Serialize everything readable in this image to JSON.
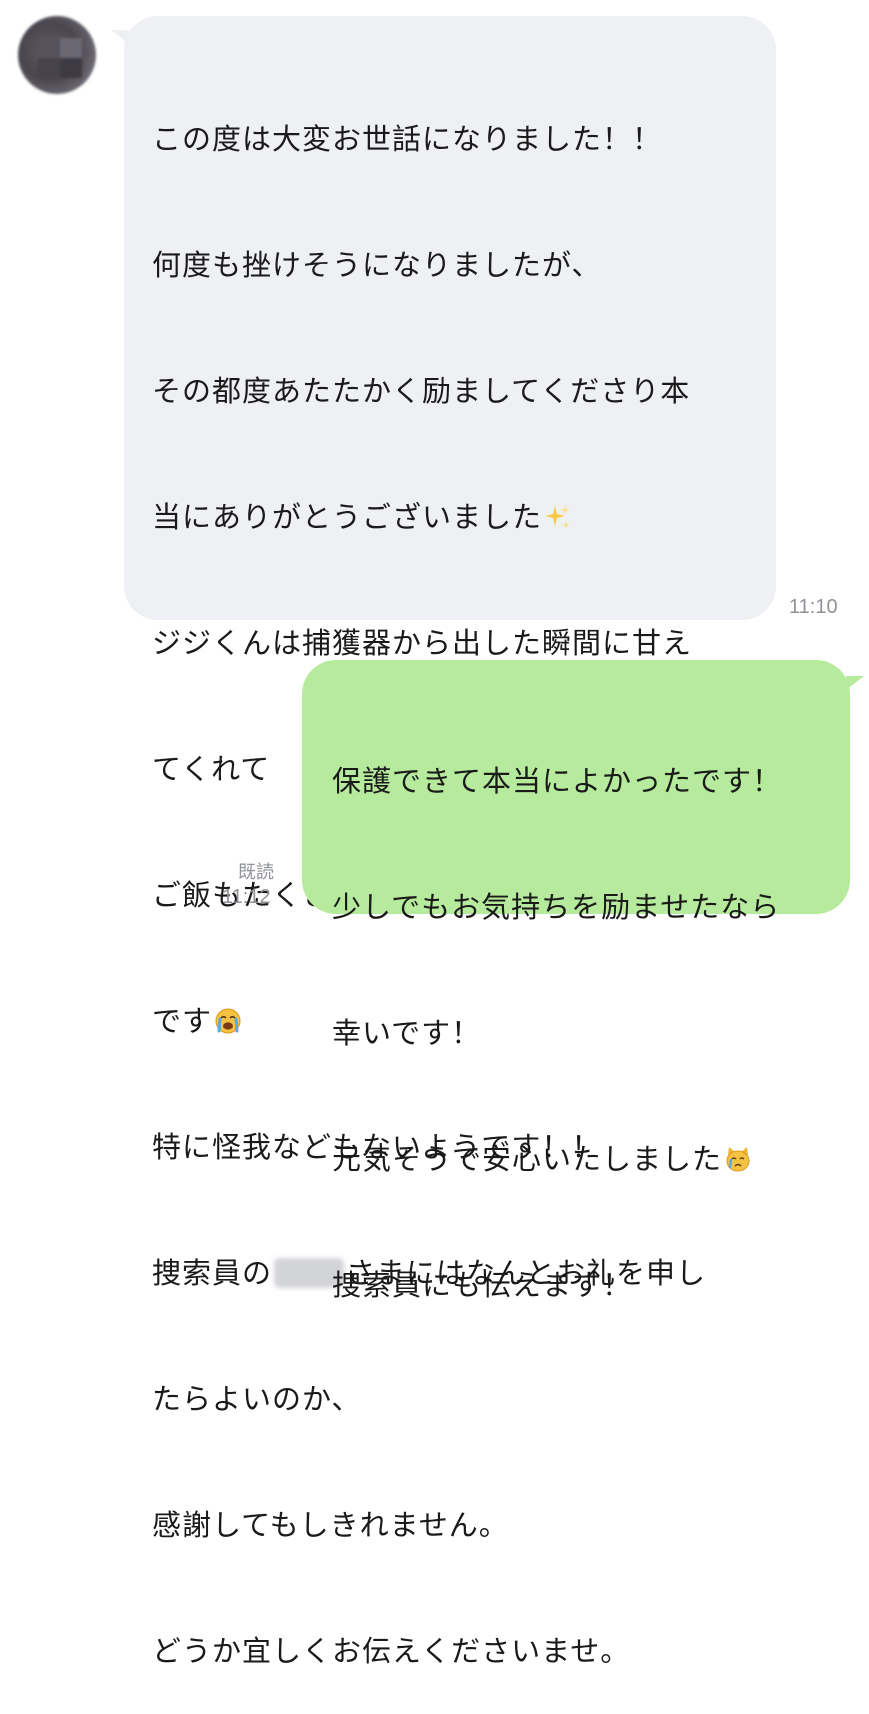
{
  "incoming": {
    "lines": [
      "この度は大変お世話になりました！！",
      "何度も挫けそうになりましたが、",
      "その都度あたたかく励ましてくださり本",
      "当にありがとうございました",
      "ジジくんは捕獲器から出した瞬間に甘え",
      "てくれて",
      "ご飯もたくさん食べてくれたので一安心",
      "です",
      "特に怪我などもないようです！！",
      "捜索員の",
      "さまにはなんとお礼を申し",
      "たらよいのか、",
      "感謝してもしきれません。",
      "どうか宜しくお伝えくださいませ。"
    ],
    "time": "11:10"
  },
  "outgoing": {
    "lines": [
      "保護できて本当によかったです！",
      "少しでもお気持ちを励ませたなら",
      "幸いです！",
      "元気そうで安心いたしました",
      "捜索員にも伝えます！"
    ],
    "read_label": "既読",
    "time": "11:12"
  },
  "icons": [
    "avatar",
    "sparkles-icon",
    "loudly-crying-face-icon",
    "crying-cat-face-icon"
  ],
  "colors": {
    "incoming_bubble": "#eff0f3",
    "outgoing_bubble": "#b6ea9c",
    "timestamp": "#8f9296"
  }
}
